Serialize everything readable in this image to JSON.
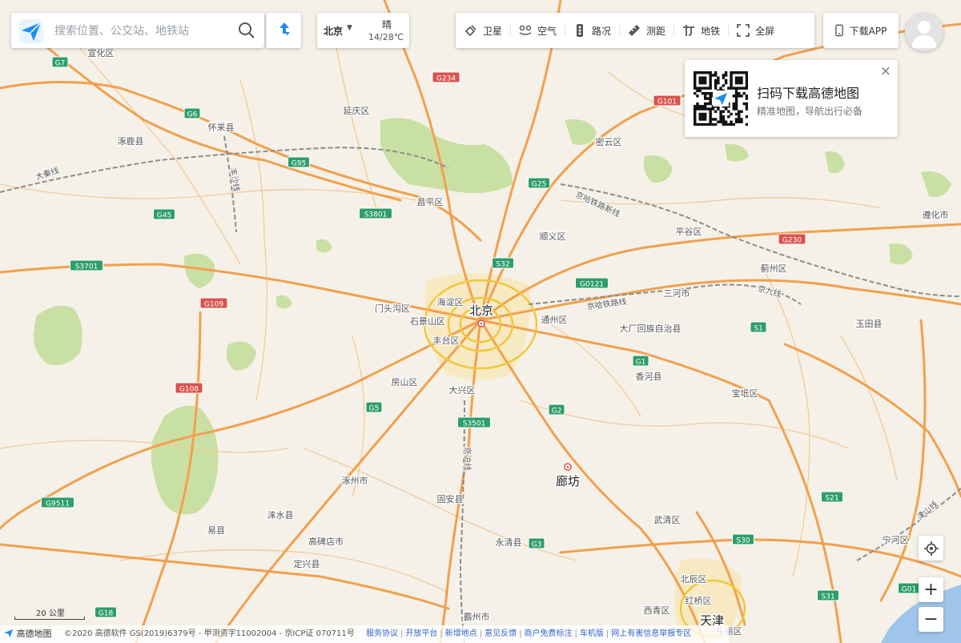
{
  "search": {
    "placeholder": "搜索位置、公交站、地铁站"
  },
  "city": {
    "name": "北京",
    "weather": "晴",
    "temperature": "14/28℃"
  },
  "toolbar": [
    {
      "icon": "satellite-icon",
      "label": "卫星"
    },
    {
      "icon": "air-quality-icon",
      "label": "空气"
    },
    {
      "icon": "traffic-icon",
      "label": "路况"
    },
    {
      "icon": "ruler-icon",
      "label": "测距"
    },
    {
      "icon": "subway-icon",
      "label": "地铁"
    },
    {
      "icon": "fullscreen-icon",
      "label": "全屏"
    }
  ],
  "app_button": "下载APP",
  "qr_popup": {
    "title": "扫码下载高德地图",
    "subtitle": "精准地图，导航出行必备",
    "close": "×"
  },
  "cities": [
    {
      "name": "北京",
      "size": "major"
    },
    {
      "name": "廊坊",
      "size": "major"
    },
    {
      "name": "天津",
      "size": "major"
    }
  ],
  "districts": [
    "延庆区",
    "怀柔区",
    "密云区",
    "昌平区",
    "平谷区",
    "顺义区",
    "海淀区",
    "门头沟区",
    "石景山区",
    "丰台区",
    "通州区",
    "房山区",
    "大兴区",
    "蓟州区",
    "三河市",
    "大厂回族自治县",
    "香河县",
    "宝坻区",
    "玉田县",
    "遵化市",
    "涿州市",
    "固安县",
    "永清县",
    "武清区",
    "宁河区",
    "北辰区",
    "红桥区",
    "西青区",
    "东丽区",
    "霸州市",
    "涞水县",
    "易县",
    "高碑店市",
    "定兴县",
    "涿鹿县",
    "怀来县",
    "宣化区"
  ],
  "highways": [
    {
      "label": "G7",
      "color": "#2e9e6b"
    },
    {
      "label": "G6",
      "color": "#2e9e6b"
    },
    {
      "label": "G95",
      "color": "#2e9e6b"
    },
    {
      "label": "G45",
      "color": "#2e9e6b"
    },
    {
      "label": "G25",
      "color": "#2e9e6b"
    },
    {
      "label": "S3801",
      "color": "#2e9e6b"
    },
    {
      "label": "S32",
      "color": "#2e9e6b"
    },
    {
      "label": "G0121",
      "color": "#2e9e6b"
    },
    {
      "label": "S3701",
      "color": "#2e9e6b"
    },
    {
      "label": "G1",
      "color": "#2e9e6b"
    },
    {
      "label": "S1",
      "color": "#2e9e6b"
    },
    {
      "label": "G5",
      "color": "#2e9e6b"
    },
    {
      "label": "S3501",
      "color": "#2e9e6b"
    },
    {
      "label": "G2",
      "color": "#2e9e6b"
    },
    {
      "label": "G9511",
      "color": "#2e9e6b"
    },
    {
      "label": "G3",
      "color": "#2e9e6b"
    },
    {
      "label": "S30",
      "color": "#2e9e6b"
    },
    {
      "label": "S21",
      "color": "#2e9e6b"
    },
    {
      "label": "G18",
      "color": "#2e9e6b"
    },
    {
      "label": "S31",
      "color": "#2e9e6b"
    },
    {
      "label": "G01",
      "color": "#2e9e6b"
    },
    {
      "label": "G234",
      "color": "#d9534f"
    },
    {
      "label": "G101",
      "color": "#d9534f"
    },
    {
      "label": "G230",
      "color": "#d9534f"
    },
    {
      "label": "G109",
      "color": "#d9534f"
    },
    {
      "label": "G108",
      "color": "#d9534f"
    }
  ],
  "railways": [
    "大秦线",
    "丰沙线",
    "京哈铁路新线",
    "京哈铁路线",
    "京九线",
    "京沪线",
    "津山线"
  ],
  "scale": "20 公里",
  "footer": {
    "brand": "高德地图",
    "copyright": "©2020 高德软件 GS(2019)6379号 - 甲测资字11002004 - 京ICP证 070711号",
    "links": [
      "服务协议",
      "开放平台",
      "新增地点",
      "意见反馈",
      "商户免费标注",
      "车机版",
      "网上有害信息举报专区"
    ]
  },
  "colors": {
    "land": "#f5f1e8",
    "green": "#c9e0a4",
    "highway": "#f2a04e",
    "ring": "#f0c73c",
    "water": "#9fc6ea"
  }
}
